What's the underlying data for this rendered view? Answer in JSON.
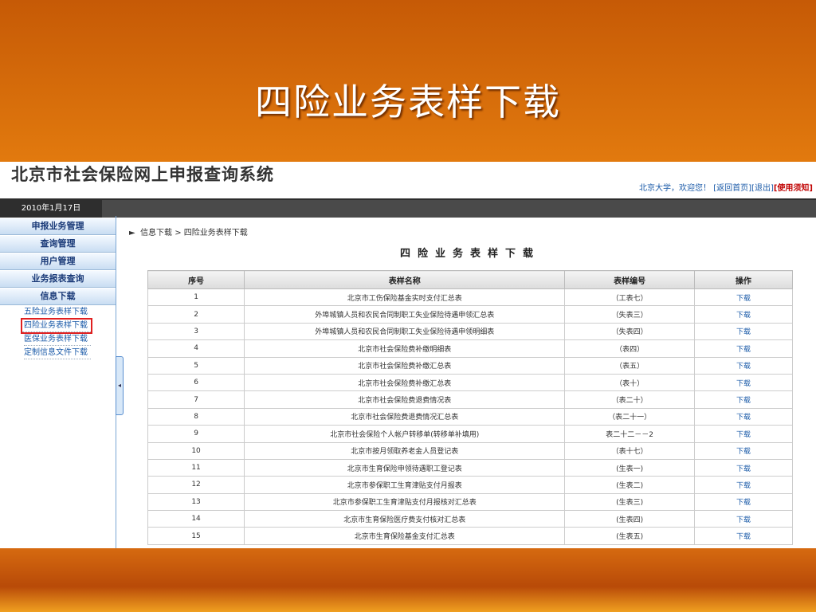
{
  "slide": {
    "title": "四险业务表样下载"
  },
  "app": {
    "system_title": "北京市社会保险网上申报查询系统",
    "user_bar": {
      "welcome": "北京大学，欢迎您！",
      "home": "[返回首页]",
      "logout": "[退出]",
      "notice": "[使用须知]"
    },
    "date": "2010年1月17日"
  },
  "sidebar": {
    "menus": [
      "申报业务管理",
      "查询管理",
      "用户管理",
      "业务报表查询",
      "信息下载"
    ],
    "sub_items": [
      "五险业务表样下载",
      "四险业务表样下载",
      "医保业务表样下载",
      "定制信息文件下载"
    ],
    "active_sub": "四险业务表样下载"
  },
  "breadcrumb": {
    "arrow": "►",
    "path": "信息下载 > 四险业务表样下载"
  },
  "table": {
    "title": "四险业务表样下载",
    "headers": [
      "序号",
      "表样名称",
      "表样编号",
      "操作"
    ],
    "rows": [
      [
        "1",
        "北京市工伤保险基金实时支付汇总表",
        "（工表七）",
        "下载"
      ],
      [
        "2",
        "外埠城镇人员和农民合同制职工失业保险待遇申领汇总表",
        "（失表三）",
        "下载"
      ],
      [
        "3",
        "外埠城镇人员和农民合同制职工失业保险待遇申领明细表",
        "（失表四）",
        "下载"
      ],
      [
        "4",
        "北京市社会保险费补缴明细表",
        "（表四）",
        "下载"
      ],
      [
        "5",
        "北京市社会保险费补缴汇总表",
        "（表五）",
        "下载"
      ],
      [
        "6",
        "北京市社会保险费补缴汇总表",
        "（表十）",
        "下载"
      ],
      [
        "7",
        "北京市社会保险费退费情况表",
        "（表二十）",
        "下载"
      ],
      [
        "8",
        "北京市社会保险费退费情况汇总表",
        "（表二十一）",
        "下载"
      ],
      [
        "9",
        "北京市社会保险个人帐户转移单(转移单补填用)",
        "表二十二－－2",
        "下载"
      ],
      [
        "10",
        "北京市按月领取养老金人员登记表",
        "（表十七）",
        "下载"
      ],
      [
        "11",
        "北京市生育保险申领待遇职工登记表",
        "(生表一)",
        "下载"
      ],
      [
        "12",
        "北京市参保职工生育津贴支付月报表",
        "(生表二)",
        "下载"
      ],
      [
        "13",
        "北京市参保职工生育津贴支付月报核对汇总表",
        "(生表三)",
        "下载"
      ],
      [
        "14",
        "北京市生育保险医疗费支付核对汇总表",
        "(生表四)",
        "下载"
      ],
      [
        "15",
        "北京市生育保险基金支付汇总表",
        "(生表五)",
        "下载"
      ]
    ]
  },
  "colors": {
    "accent": "#1a5aa8",
    "slide_bg": "#f08a12",
    "highlight": "#e02020"
  },
  "icons": {
    "collapse": "chevron-left-icon"
  }
}
